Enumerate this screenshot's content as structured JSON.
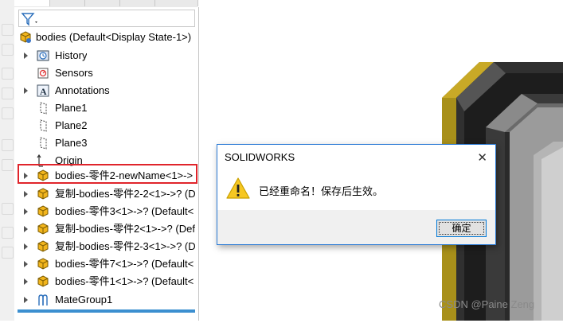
{
  "tree": {
    "root_label": "bodies  (Default<Display State-1>)",
    "items": [
      {
        "label": "History"
      },
      {
        "label": "Sensors"
      },
      {
        "label": "Annotations"
      },
      {
        "label": "Plane1"
      },
      {
        "label": "Plane2"
      },
      {
        "label": "Plane3"
      },
      {
        "label": "Origin"
      },
      {
        "label": "bodies-零件2-newName<1>->"
      },
      {
        "label": "复制-bodies-零件2-2<1>->? (D"
      },
      {
        "label": "bodies-零件3<1>->? (Default<"
      },
      {
        "label": "复制-bodies-零件2<1>->? (Def"
      },
      {
        "label": "复制-bodies-零件2-3<1>->? (D"
      },
      {
        "label": "bodies-零件7<1>->? (Default<"
      },
      {
        "label": "bodies-零件1<1>->? (Default<"
      },
      {
        "label": "MateGroup1"
      }
    ]
  },
  "dialog": {
    "title": "SOLIDWORKS",
    "close": "✕",
    "message": "已经重命名！保存后生效。",
    "ok_label": "确定"
  },
  "watermark": "CSDN @Paine Zeng",
  "colors": {
    "accent": "#2b7bd6",
    "highlight": "#e0242b",
    "part_icon": "#f2b51c",
    "model_gold": "#9c8313",
    "model_dark": "#2a2a2a"
  }
}
